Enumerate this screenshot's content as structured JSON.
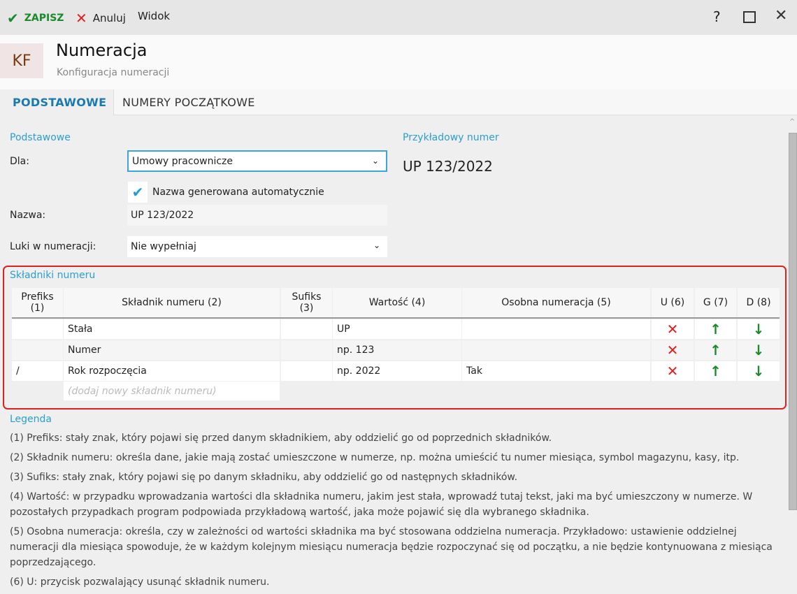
{
  "toolbar": {
    "save": "ZAPISZ",
    "cancel": "Anuluj",
    "view": "Widok",
    "help": "?"
  },
  "header": {
    "badge": "KF",
    "title": "Numeracja",
    "subtitle": "Konfiguracja numeracji"
  },
  "tabs": [
    {
      "label": "PODSTAWOWE"
    },
    {
      "label": "NUMERY POCZĄTKOWE"
    }
  ],
  "basic": {
    "section": "Podstawowe",
    "dla_label": "Dla:",
    "dla_value": "Umowy pracownicze",
    "auto_label": "Nazwa generowana automatycznie",
    "auto_checked": true,
    "nazwa_label": "Nazwa:",
    "nazwa_value": "UP 123/2022",
    "luki_label": "Luki w numeracji:",
    "luki_value": "Nie wypełniaj"
  },
  "example": {
    "label": "Przykładowy numer",
    "value": "UP 123/2022"
  },
  "components": {
    "section": "Składniki numeru",
    "headers": [
      "Prefiks\n(1)",
      "Składnik numeru (2)",
      "Sufiks\n(3)",
      "Wartość (4)",
      "Osobna numeracja (5)",
      "U (6)",
      "G (7)",
      "D (8)"
    ],
    "rows": [
      {
        "prefix": "",
        "name": "Stała",
        "suffix": "",
        "value": "UP",
        "separate": ""
      },
      {
        "prefix": "",
        "name": "Numer",
        "suffix": "",
        "value": "np. 123",
        "separate": ""
      },
      {
        "prefix": "/",
        "name": "Rok rozpoczęcia",
        "suffix": "",
        "value": "np. 2022",
        "separate": "Tak"
      }
    ],
    "add_placeholder": "(dodaj nowy składnik numeru)"
  },
  "legend": {
    "title": "Legenda",
    "items": [
      "(1) Prefiks: stały znak, który pojawi się przed danym składnikiem, aby oddzielić go od poprzednich składników.",
      "(2) Składnik numeru: określa dane, jakie mają zostać umieszczone w numerze, np. można umieścić tu numer miesiąca, symbol magazynu, kasy, itp.",
      "(3) Sufiks: stały znak, który pojawi się po danym składniku, aby oddzielić go od następnych składników.",
      "(4) Wartość: w przypadku wprowadzania wartości dla składnika numeru, jakim jest stała,  wprowadź tutaj tekst, jaki ma być umieszczony  w numerze. W pozostałych przypadkach program podpowiada przykładową wartość, jaka może pojawić się dla wybranego składnika.",
      "(5) Osobna numeracja: określa, czy w zależności od wartości składnika ma być stosowana oddzielna numeracja. Przykładowo: ustawienie oddzielnej numeracji dla miesiąca spowoduje, że w każdym kolejnym miesiącu numeracja będzie rozpoczynać się od początku, a nie będzie kontynuowana z miesiąca poprzedzającego.",
      "(6) U: przycisk pozwalający usunąć składnik numeru."
    ]
  },
  "colors": {
    "accent": "#1a7ab0",
    "green": "#1a8a2a",
    "red": "#e02020"
  }
}
